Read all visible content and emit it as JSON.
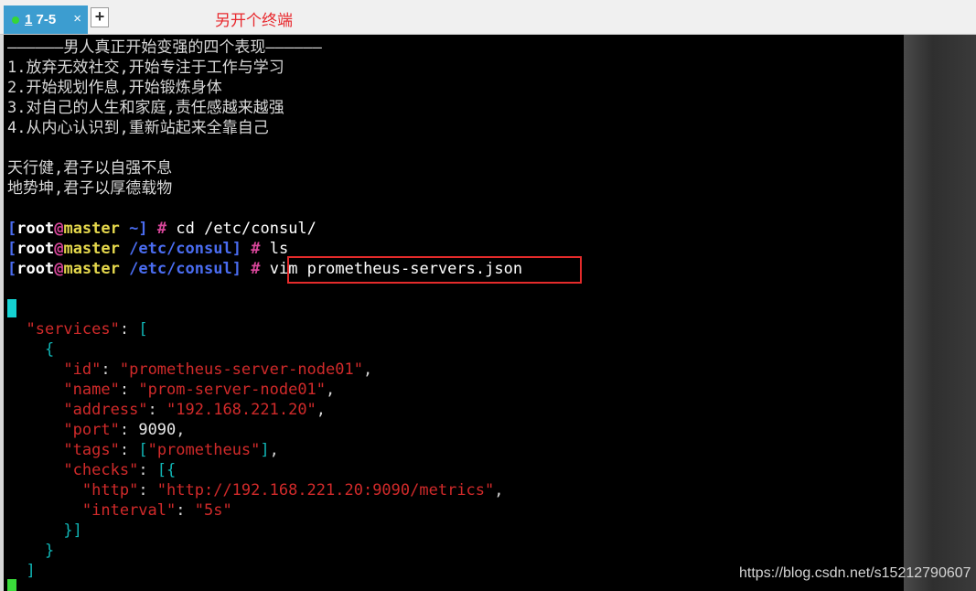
{
  "tab": {
    "number": "1",
    "label": "7-5",
    "close_glyph": "×"
  },
  "new_tab_glyph": "+",
  "annotation": "另开个终端",
  "banner": {
    "title_line": "——————男人真正开始变强的四个表现——————",
    "lines": [
      "1.放弃无效社交,开始专注于工作与学习",
      "2.开始规划作息,开始锻炼身体",
      "3.对自己的人生和家庭,责任感越来越强",
      "4.从内心认识到,重新站起来全靠自己"
    ],
    "quotes": [
      "天行健,君子以自强不息",
      "地势坤,君子以厚德载物"
    ]
  },
  "prompts": [
    {
      "user": "root",
      "at": "@",
      "host": "master",
      "cwd": "~",
      "symbol": "#",
      "command": "cd /etc/consul/"
    },
    {
      "user": "root",
      "at": "@",
      "host": "master",
      "cwd": "/etc/consul",
      "symbol": "#",
      "command": "ls"
    },
    {
      "user": "root",
      "at": "@",
      "host": "master",
      "cwd": "/etc/consul",
      "symbol": "#",
      "command": "vim prometheus-servers.json"
    }
  ],
  "json_file": {
    "services_key": "\"services\"",
    "id_key": "\"id\"",
    "id_value": "\"prometheus-server-node01\"",
    "name_key": "\"name\"",
    "name_value": "\"prom-server-node01\"",
    "address_key": "\"address\"",
    "address_value": "\"192.168.221.20\"",
    "port_key": "\"port\"",
    "port_value": "9090",
    "tags_key": "\"tags\"",
    "tags_value": "\"prometheus\"",
    "checks_key": "\"checks\"",
    "http_key": "\"http\"",
    "http_value": "\"http://192.168.221.20:9090/metrics\"",
    "interval_key": "\"interval\"",
    "interval_value": "\"5s\""
  },
  "watermark": "https://blog.csdn.net/s15212790607",
  "colors": {
    "tab_active": "#3c9dd0",
    "prompt_bracket": "#4a6cf0",
    "prompt_at": "#d8469a",
    "prompt_host": "#e5d84c",
    "json_key": "#d12a2a",
    "json_brace": "#10b5b5",
    "cursor": "#14d2d2",
    "highlight_box": "#e52b2b"
  }
}
